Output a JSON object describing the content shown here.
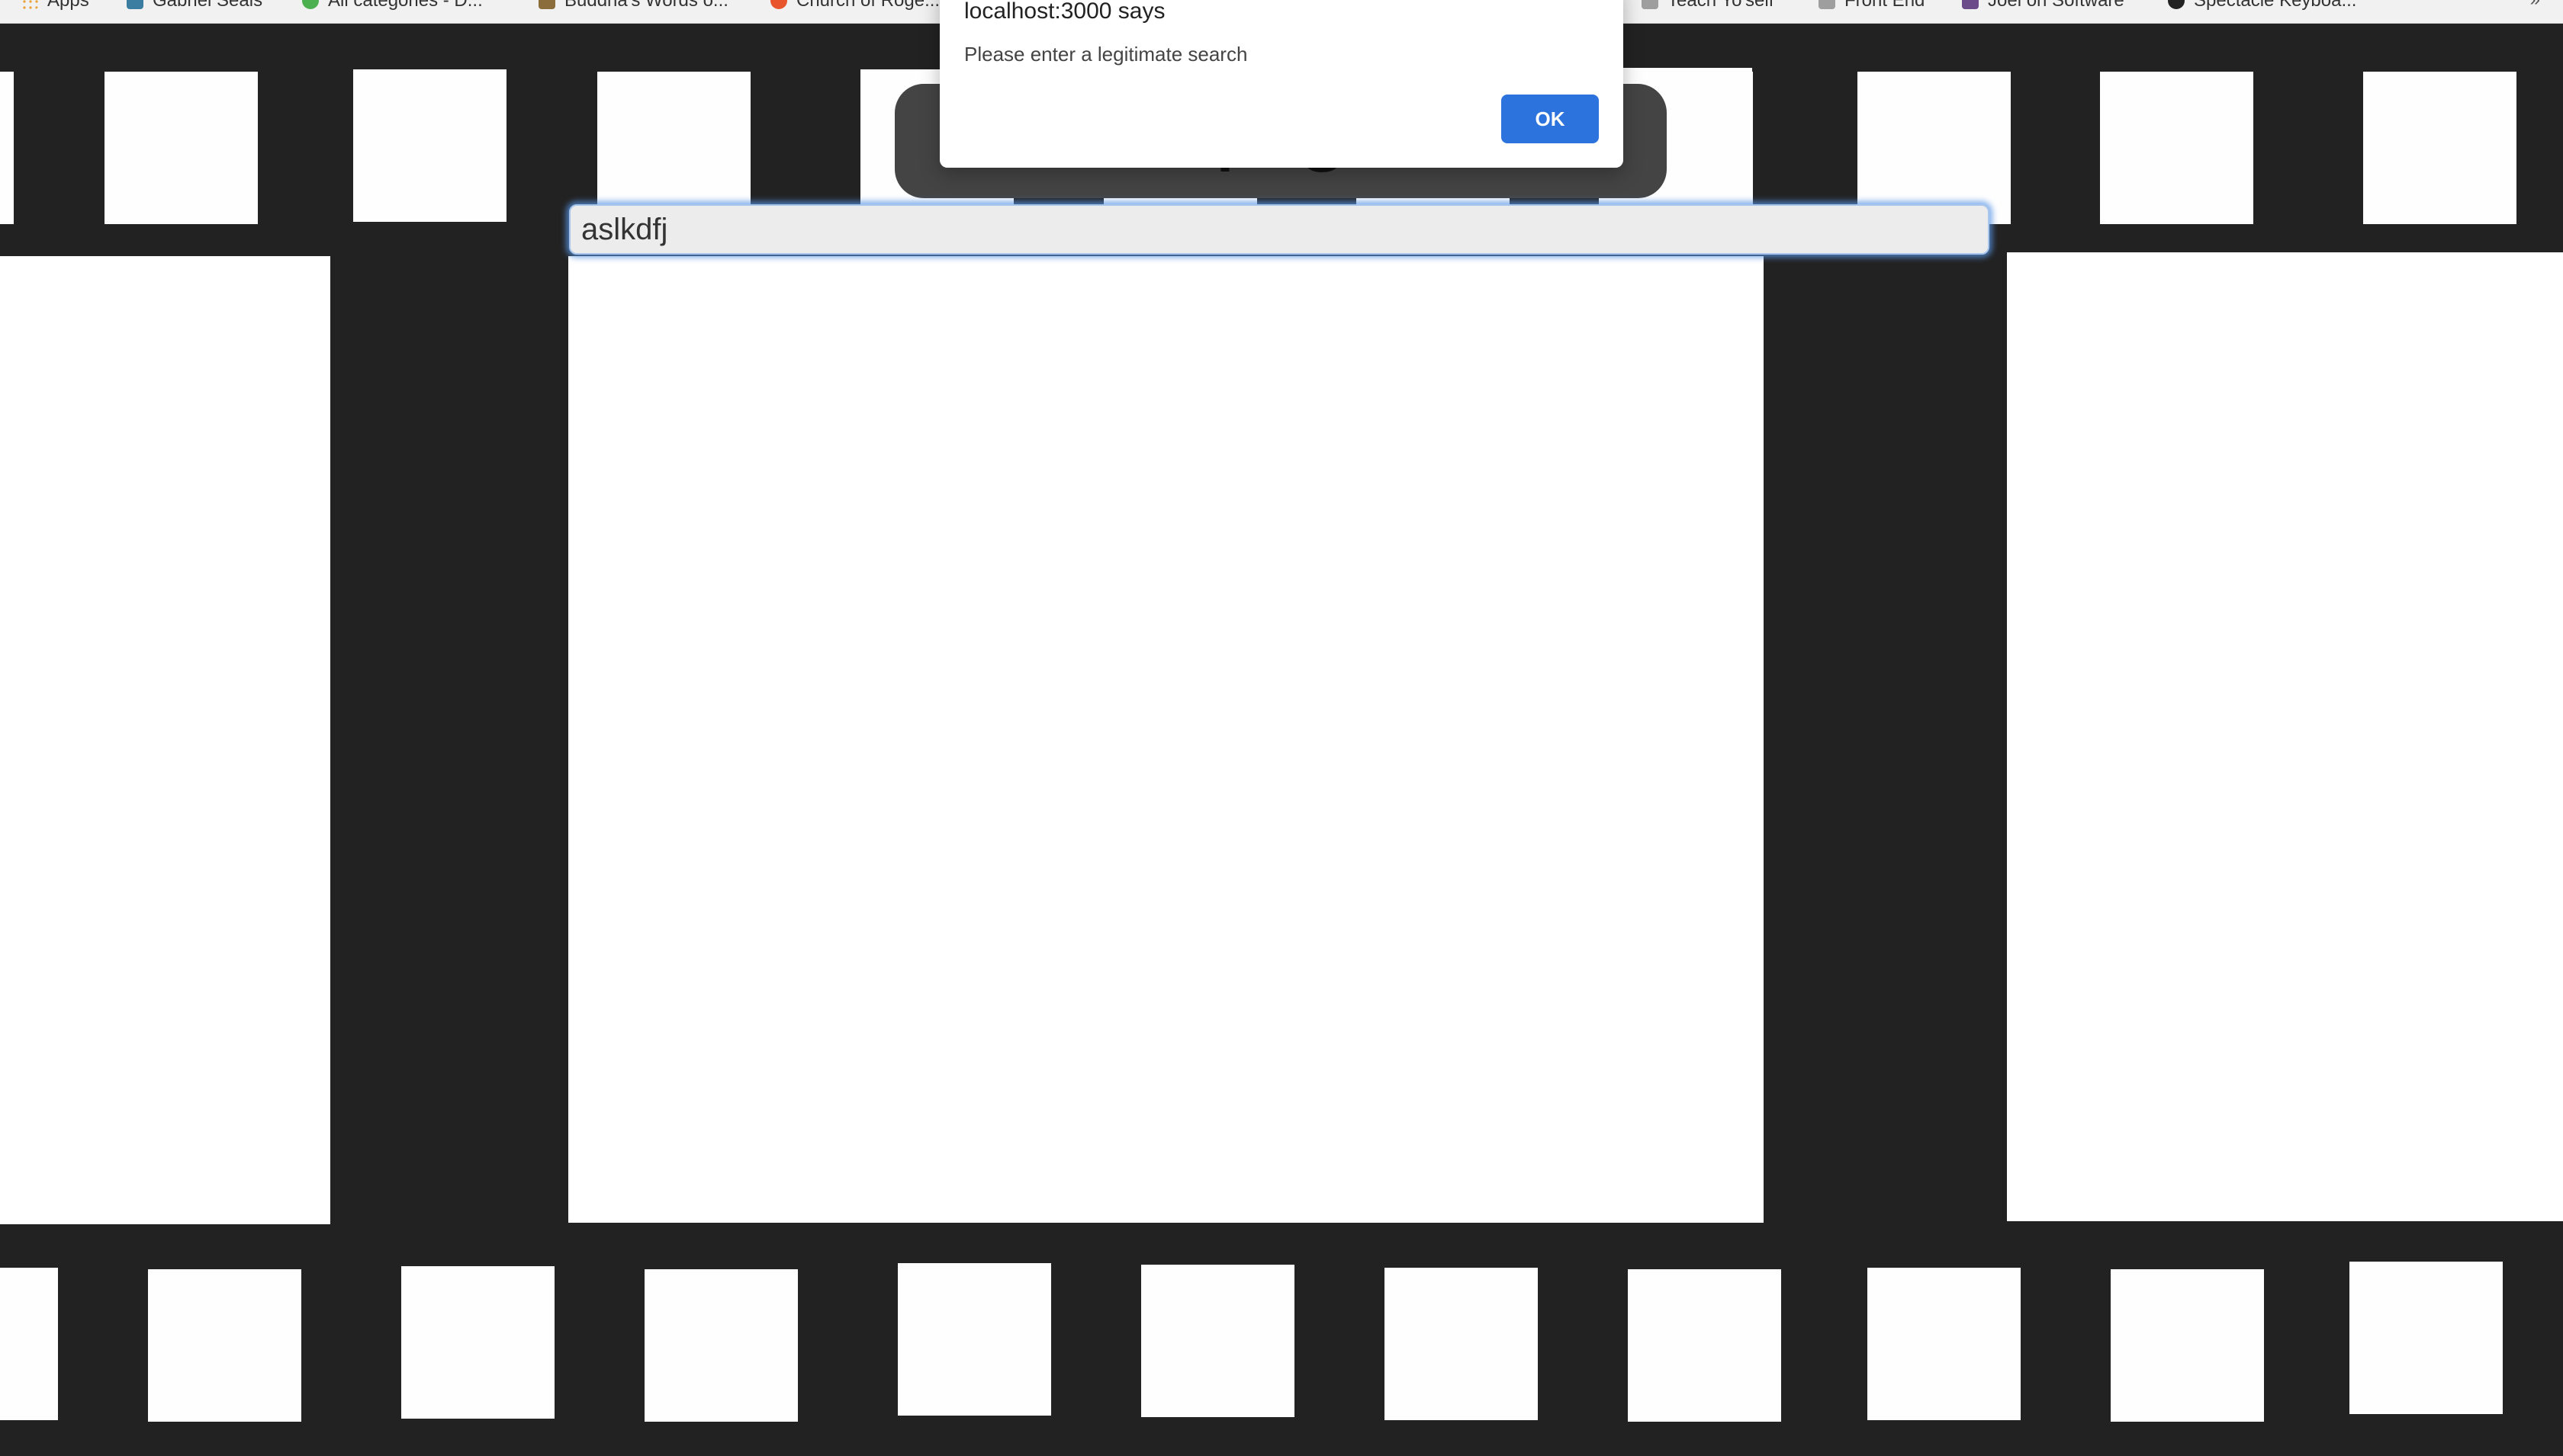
{
  "bookmarks": [
    {
      "label": "Apps",
      "icon": "apps-grid-icon",
      "color": "#e8a33d"
    },
    {
      "label": "Gabriel Seals",
      "icon": "bookmark-favicon-icon",
      "color": "#3b7ea1"
    },
    {
      "label": "All categories - D...",
      "icon": "bookmark-favicon-icon",
      "color": "#4caf50"
    },
    {
      "label": "Buddha's Words o...",
      "icon": "bookmark-favicon-icon",
      "color": "#8a6d3b"
    },
    {
      "label": "Church of Roge...",
      "icon": "bookmark-favicon-icon",
      "color": "#e8552d"
    },
    {
      "label": "Teach Yo'self",
      "icon": "folder-icon",
      "color": "#9e9e9e"
    },
    {
      "label": "Front End",
      "icon": "folder-icon",
      "color": "#9e9e9e"
    },
    {
      "label": "Joel on Software",
      "icon": "bookmark-favicon-icon",
      "color": "#6b4b8a"
    },
    {
      "label": "Spectacle Keyboa...",
      "icon": "github-icon",
      "color": "#222222"
    }
  ],
  "bookmarks_more": "»",
  "page": {
    "title_partial": "F                  e",
    "search_value": "aslkdfj"
  },
  "dialog": {
    "title": "localhost:3000 says",
    "message": "Please enter a legitimate search",
    "ok_label": "OK"
  },
  "colors": {
    "film": "#222222",
    "title_pill": "#444444",
    "ok_button": "#2d73de",
    "focus_glow": "#5a96e6"
  }
}
